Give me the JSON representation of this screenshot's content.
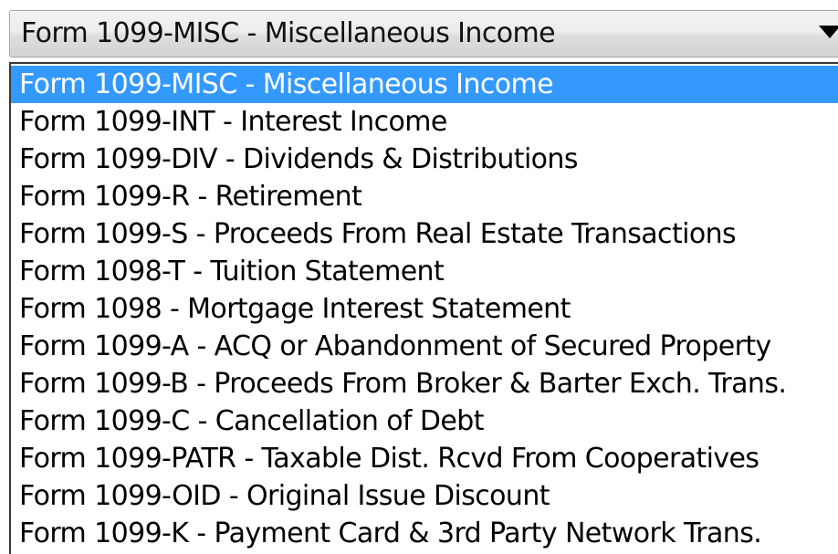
{
  "combo": {
    "selected_label": "Form 1099-MISC - Miscellaneous Income",
    "arrow_icon": "chevron-down-icon"
  },
  "dropdown": {
    "selected_color": "#3399ff",
    "options": [
      "Form 1099-MISC - Miscellaneous Income",
      "Form 1099-INT - Interest Income",
      "Form 1099-DIV - Dividends & Distributions",
      "Form 1099-R - Retirement",
      "Form 1099-S - Proceeds From Real Estate Transactions",
      "Form 1098-T - Tuition Statement",
      "Form 1098 - Mortgage Interest Statement",
      "Form 1099-A - ACQ or Abandonment of Secured Property",
      "Form 1099-B - Proceeds From Broker & Barter Exch. Trans.",
      "Form 1099-C - Cancellation of Debt",
      "Form 1099-PATR - Taxable Dist. Rcvd From Cooperatives",
      "Form 1099-OID - Original Issue Discount",
      "Form 1099-K - Payment Card & 3rd Party Network Trans."
    ]
  }
}
